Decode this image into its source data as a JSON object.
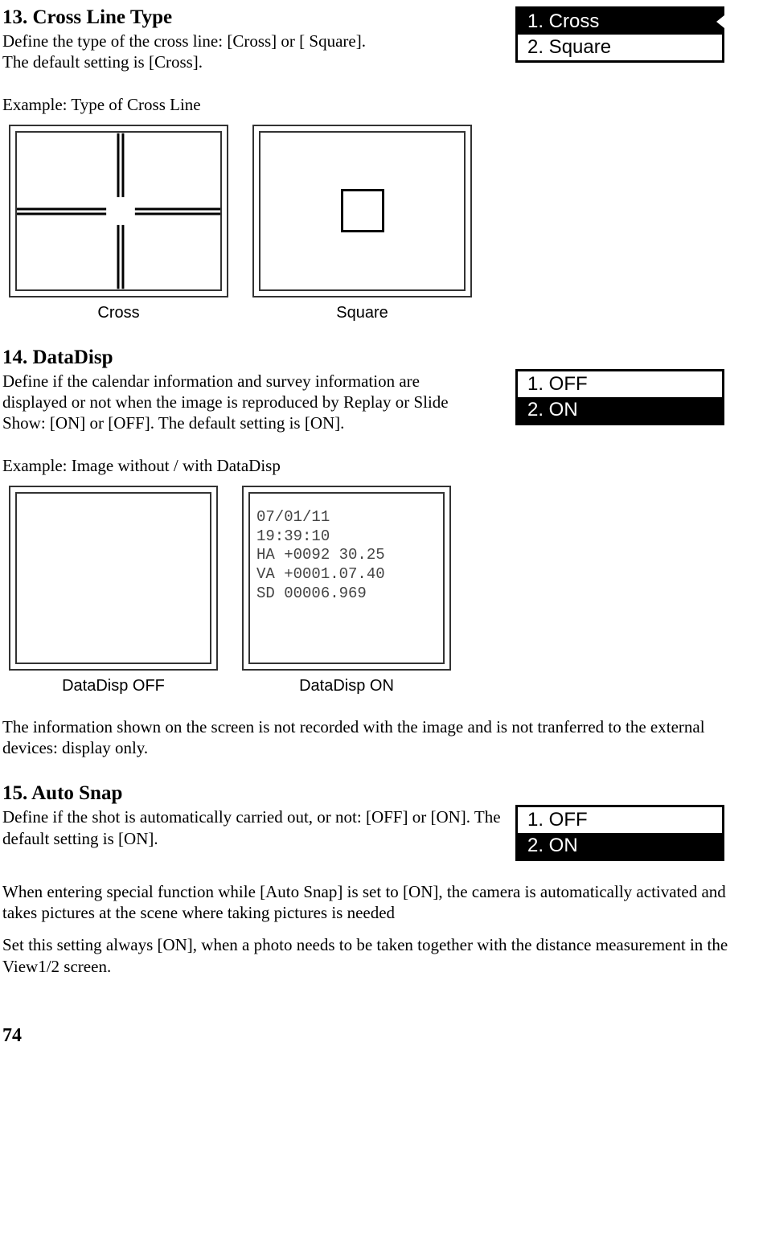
{
  "s13": {
    "heading": "13. Cross Line Type",
    "body1": "Define the type of the cross line: [Cross] or [ Square].",
    "body2": "The default setting is [Cross].",
    "example": "Example: Type of Cross Line",
    "menu": {
      "opt1": "1. Cross",
      "opt2": "2. Square"
    },
    "figLabels": {
      "cross": "Cross",
      "square": "Square"
    }
  },
  "s14": {
    "heading": "14. DataDisp",
    "body": "Define if the calendar information and survey information are displayed or not when the image is reproduced by Replay or Slide Show: [ON] or [OFF]. The default setting is [ON].",
    "example": "Example: Image without / with DataDisp",
    "menu": {
      "opt1": "1. OFF",
      "opt2": "2. ON"
    },
    "figLabels": {
      "off": "DataDisp OFF",
      "on": "DataDisp ON"
    },
    "overlay": {
      "l1": "07/01/11",
      "l2": "19:39:10",
      "l3": "HA +0092 30.25",
      "l4": "VA +0001.07.40",
      "l5": "SD  00006.969"
    },
    "note": "The information shown on the screen is not recorded with the image and is not tranferred to the external devices: display only."
  },
  "s15": {
    "heading": "15. Auto Snap",
    "body": "Define if the shot is automatically carried out, or not: [OFF] or [ON]. The default setting is [ON].",
    "menu": {
      "opt1": "1. OFF",
      "opt2": "2. ON"
    },
    "p2": "When entering special function while [Auto Snap] is set to [ON], the camera is automatically activated and takes pictures at the scene where taking pictures is needed",
    "p3": "Set this setting always [ON], when a photo needs to be taken together with the distance measurement in the View1/2 screen."
  },
  "pageNumber": "74"
}
